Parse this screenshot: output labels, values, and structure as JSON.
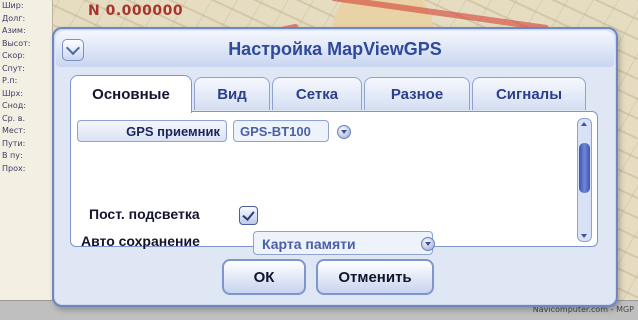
{
  "map": {
    "coordinate": "N 0.000000",
    "side_rows": [
      "Шир:",
      "Долг:",
      "Азим:",
      "Высот:",
      "Скор:",
      "Спут:",
      "Р.п:",
      "Шрх:",
      "Снод:",
      "Ср. в.",
      "Мест:",
      "Пути:",
      "В пу:",
      "Прох:"
    ],
    "credit": "Navicomputer.com - MGP"
  },
  "dialog": {
    "title": "Настройка MapViewGPS",
    "menu_icon": "chevron-down-icon",
    "tabs": [
      {
        "label": "Основные",
        "active": true
      },
      {
        "label": "Вид",
        "active": false
      },
      {
        "label": "Сетка",
        "active": false
      },
      {
        "label": "Разное",
        "active": false
      },
      {
        "label": "Сигналы",
        "active": false
      }
    ],
    "gps": {
      "label": "GPS приемник",
      "value": "GPS-BT100"
    },
    "backlight": {
      "label": "Пост. подсветка",
      "checked": true
    },
    "autosave": {
      "label": "Авто сохранение",
      "value": "Карта памяти"
    },
    "buttons": {
      "ok": "ОК",
      "cancel": "Отменить"
    }
  },
  "colors": {
    "accent": "#2f4a9a",
    "coordinate": "#a8352c"
  }
}
